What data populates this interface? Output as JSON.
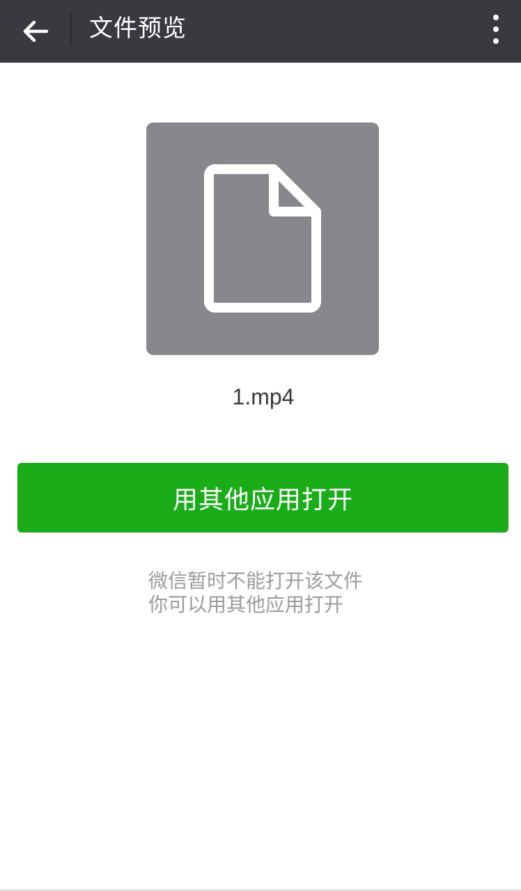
{
  "header": {
    "title": "文件预览",
    "back_icon": "arrow-left-icon",
    "more_icon": "more-vertical-icon"
  },
  "file": {
    "icon": "file-icon",
    "name": "1.mp4"
  },
  "actions": {
    "open_with_label": "用其他应用打开"
  },
  "hint": {
    "line1": "微信暂时不能打开该文件",
    "line2": "你可以用其他应用打开"
  },
  "colors": {
    "topbar_bg": "#393a3f",
    "accent_green": "#1aad19",
    "tile_gray": "#88878c",
    "hint_text": "#9b9b9b"
  }
}
